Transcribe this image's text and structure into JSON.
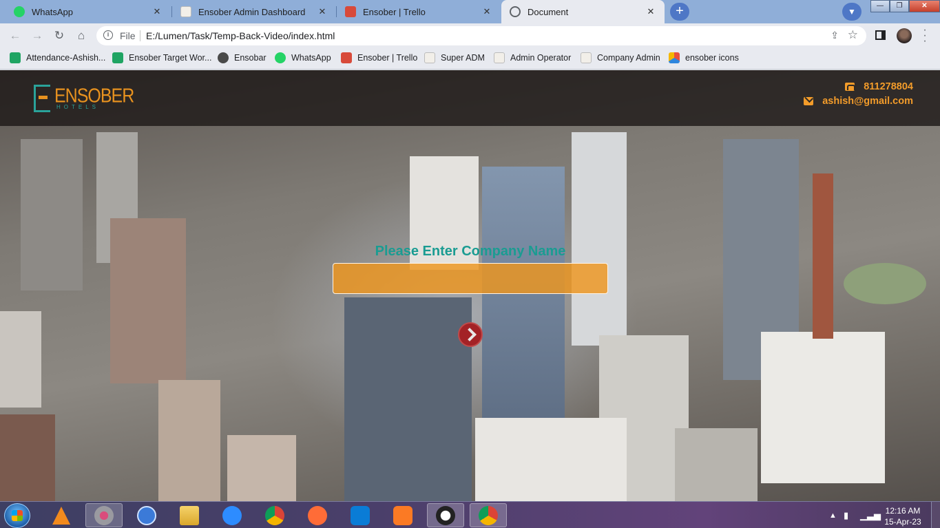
{
  "tabs": [
    {
      "title": "WhatsApp",
      "favicon": "whatsapp-icon",
      "color": "#25d366"
    },
    {
      "title": "Ensober Admin Dashboard",
      "favicon": "page-icon",
      "color": "#f2efe9"
    },
    {
      "title": "Ensober | Trello",
      "favicon": "trello-icon",
      "color": "#d84a3a"
    },
    {
      "title": "Document",
      "favicon": "globe-icon",
      "color": "#5f6368"
    }
  ],
  "toolbar": {
    "scheme": "File",
    "url": "E:/Lumen/Task/Temp-Back-Video/index.html"
  },
  "bookmarks": [
    {
      "label": "Attendance-Ashish...",
      "icon": "sheets-icon",
      "color": "#1fa463"
    },
    {
      "label": "Ensober Target Wor...",
      "icon": "sheets-icon",
      "color": "#1fa463"
    },
    {
      "label": "Ensobar",
      "icon": "code-icon",
      "color": "#4a4a4a"
    },
    {
      "label": "WhatsApp",
      "icon": "whatsapp-icon",
      "color": "#25d366"
    },
    {
      "label": "Ensober | Trello",
      "icon": "trello-icon",
      "color": "#d84a3a"
    },
    {
      "label": "Super ADM",
      "icon": "page-icon",
      "color": "#f2efe9"
    },
    {
      "label": "Admin Operator",
      "icon": "page-icon",
      "color": "#f2efe9"
    },
    {
      "label": "Company Admin",
      "icon": "page-icon",
      "color": "#f2efe9"
    },
    {
      "label": "ensober icons",
      "icon": "iconfont-icon",
      "color": "#e94f3c"
    }
  ],
  "page": {
    "logo_word": "ENSOBER",
    "logo_sub": "HOTELS",
    "phone": "811278804",
    "email": "ashish@gmail.com",
    "prompt": "Please Enter Company Name",
    "input_value": "",
    "accent": "#f39c2a",
    "teal": "#1a9c92"
  },
  "taskbar": {
    "apps": [
      "vlc-icon",
      "snipping-tool-icon",
      "cursor-tool-icon",
      "file-explorer-icon",
      "zoom-icon",
      "chrome-icon",
      "postman-icon",
      "vscode-icon",
      "xampp-icon",
      "camera-app-icon",
      "chrome-active-icon"
    ],
    "time": "12:16 AM",
    "date": "15-Apr-23"
  }
}
